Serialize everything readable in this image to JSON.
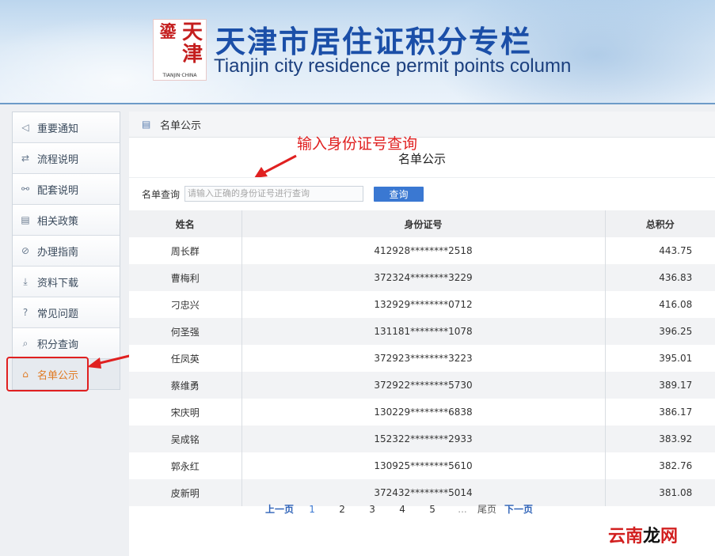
{
  "header": {
    "title": "天津市居住证积分专栏",
    "subtitle": "Tianjin city residence permit points column",
    "logo_text_a": "鎏",
    "logo_text_b": "天津",
    "logo_caption": "TIANJIN·CHINA"
  },
  "sidebar": {
    "items": [
      {
        "label": "重要通知",
        "icon": "speaker-icon",
        "glyph": "◁"
      },
      {
        "label": "流程说明",
        "icon": "flow-icon",
        "glyph": "⇄"
      },
      {
        "label": "配套说明",
        "icon": "link-icon",
        "glyph": "⚯"
      },
      {
        "label": "相关政策",
        "icon": "document-icon",
        "glyph": "▤"
      },
      {
        "label": "办理指南",
        "icon": "compass-icon",
        "glyph": "⊘"
      },
      {
        "label": "资料下载",
        "icon": "download-icon",
        "glyph": "⤓"
      },
      {
        "label": "常见问题",
        "icon": "question-icon",
        "glyph": "?"
      },
      {
        "label": "积分查询",
        "icon": "search-icon",
        "glyph": "⌕"
      },
      {
        "label": "名单公示",
        "icon": "home-icon",
        "glyph": "⌂"
      }
    ],
    "active_index": 8
  },
  "panel": {
    "breadcrumb": "名单公示",
    "annotation": "输入身份证号查询",
    "list_title": "名单公示",
    "query_label": "名单查询",
    "query_placeholder": "请输入正确的身份证号进行查询",
    "query_value": "",
    "query_button": "查询"
  },
  "table": {
    "columns": [
      "姓名",
      "身份证号",
      "总积分"
    ],
    "rows": [
      {
        "name": "周长群",
        "id": "412928********2518",
        "score": "443.75"
      },
      {
        "name": "曹梅利",
        "id": "372324********3229",
        "score": "436.83"
      },
      {
        "name": "刁忠兴",
        "id": "132929********0712",
        "score": "416.08"
      },
      {
        "name": "何圣强",
        "id": "131181********1078",
        "score": "396.25"
      },
      {
        "name": "任凤英",
        "id": "372923********3223",
        "score": "395.01"
      },
      {
        "name": "蔡维勇",
        "id": "372922********5730",
        "score": "389.17"
      },
      {
        "name": "宋庆明",
        "id": "130229********6838",
        "score": "386.17"
      },
      {
        "name": "吴成铭",
        "id": "152322********2933",
        "score": "383.92"
      },
      {
        "name": "郭永红",
        "id": "130925********5610",
        "score": "382.76"
      },
      {
        "name": "皮新明",
        "id": "372432********5014",
        "score": "381.08"
      }
    ]
  },
  "pager": {
    "prev": "上一页",
    "pages": [
      "1",
      "2",
      "3",
      "4",
      "5"
    ],
    "current": "1",
    "dots": "...",
    "last": "尾页",
    "next": "下一页"
  },
  "watermark": {
    "red": "云南",
    "black": "龙",
    "red2": "网"
  },
  "colors": {
    "accent": "#3a78d2",
    "title_blue": "#1b4fa8",
    "active_orange": "#e07b24",
    "annotation_red": "#e02020"
  }
}
